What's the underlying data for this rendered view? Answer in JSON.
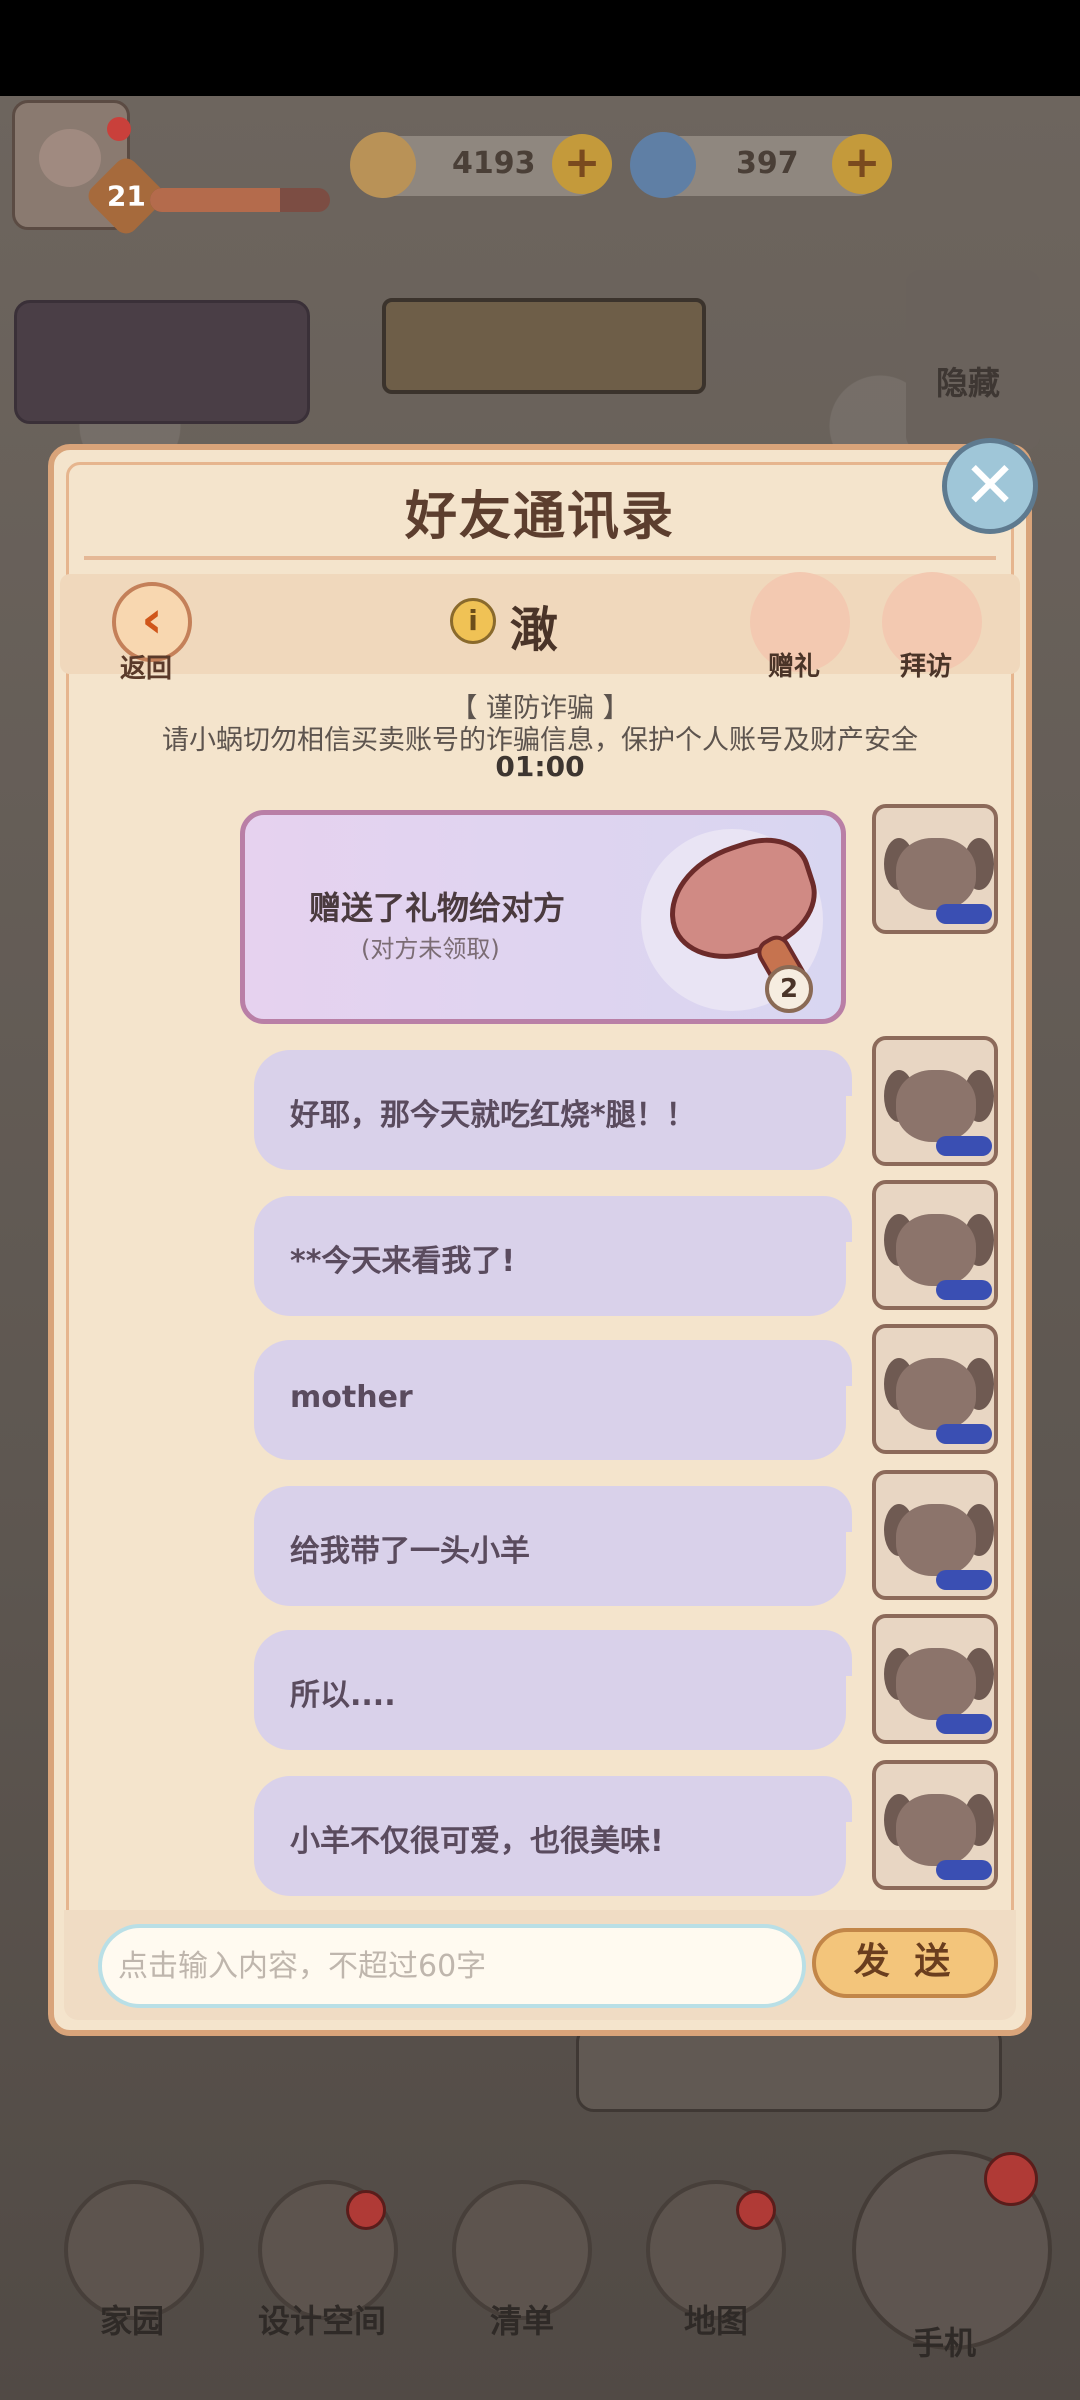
{
  "hud": {
    "level": "21",
    "xp_fraction": 0.72,
    "coins": "4193",
    "gems": "397",
    "hide_label": "隐藏"
  },
  "dialog": {
    "title": "好友通讯录",
    "back_label": "返回",
    "friend_name": "澉",
    "gift_label": "赠礼",
    "visit_label": "拜访",
    "notice_title": "【 谨防诈骗 】",
    "notice_body": "请小蜗切勿相信买卖账号的诈骗信息，保护个人账号及财产安全",
    "notice_time": "01:00",
    "gift_message": {
      "text": "赠送了礼物给对方",
      "status": "(对方未领取)",
      "count": "2"
    },
    "messages": [
      {
        "text": "好耶，那今天就吃红烧*腿！！"
      },
      {
        "text": "**今天来看我了!"
      },
      {
        "text": "mother"
      },
      {
        "text": "给我带了一头小羊"
      },
      {
        "text": "所以...."
      },
      {
        "text": "小羊不仅很可爱，也很美味!"
      }
    ],
    "input_placeholder": "点击输入内容，不超过60字",
    "send_label": "发 送"
  },
  "bottom_nav": {
    "home": "家园",
    "design": "设计空间",
    "list": "清单",
    "map": "地图",
    "phone": "手机"
  },
  "colors": {
    "dialog_bg": "#f4e4cc",
    "bubble_bg": "#d9d1ea",
    "accent_orange": "#d0561a"
  }
}
